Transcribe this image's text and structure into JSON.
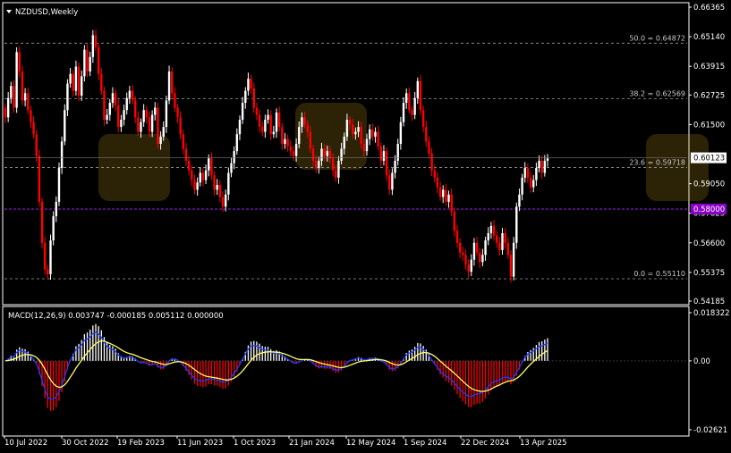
{
  "chart_title": "NZDUSD,Weekly",
  "macd_label": "MACD(12,26,9) 0.003747 -0.000185 0.005112 0.000000",
  "colors": {
    "background": "#000000",
    "bull_candle": "#ffffff",
    "bear_candle": "#ff0000",
    "macd_hist_pos": "#ffffff",
    "macd_hist_neg": "#ff0000",
    "macd_line": "#1e3cff",
    "signal_line": "#ffff66",
    "level_line": "#a020f0",
    "price_badge": "#ffffff",
    "level_badge": "#8a00c8"
  },
  "chart_data": [
    {
      "type": "candlestick",
      "title": "NZDUSD,Weekly",
      "ylim": [
        0.54185,
        0.66365
      ],
      "y_ticks": [
        "0.66365",
        "0.65140",
        "0.63915",
        "0.62725",
        "0.61500",
        "0.60123",
        "0.59050",
        "0.57825",
        "0.56600",
        "0.55375",
        "0.54185"
      ],
      "x_ticks": [
        "10 Jul 2022",
        "30 Oct 2022",
        "19 Feb 2023",
        "11 Jun 2023",
        "1 Oct 2023",
        "21 Jan 2024",
        "12 May 2024",
        "1 Sep 2024",
        "22 Dec 2024",
        "13 Apr 2025"
      ],
      "current_price": "0.60123",
      "horizontal_level": "0.58000",
      "fibonacci": [
        {
          "label": "50.0 = 0.64872",
          "value": 0.64872
        },
        {
          "label": "38.2 = 0.62569",
          "value": 0.62569
        },
        {
          "label": "23.6 = 0.59718",
          "value": 0.59718
        },
        {
          "label": "0.0 = 0.55110",
          "value": 0.5511
        }
      ],
      "closes": [
        0.618,
        0.626,
        0.631,
        0.622,
        0.645,
        0.637,
        0.625,
        0.628,
        0.621,
        0.616,
        0.611,
        0.602,
        0.583,
        0.566,
        0.555,
        0.553,
        0.567,
        0.577,
        0.583,
        0.597,
        0.608,
        0.621,
        0.632,
        0.636,
        0.629,
        0.639,
        0.627,
        0.635,
        0.646,
        0.637,
        0.643,
        0.652,
        0.647,
        0.636,
        0.629,
        0.617,
        0.619,
        0.624,
        0.628,
        0.623,
        0.614,
        0.617,
        0.621,
        0.626,
        0.629,
        0.625,
        0.618,
        0.612,
        0.616,
        0.621,
        0.618,
        0.612,
        0.619,
        0.622,
        0.607,
        0.61,
        0.614,
        0.625,
        0.637,
        0.628,
        0.622,
        0.618,
        0.611,
        0.605,
        0.6,
        0.596,
        0.592,
        0.588,
        0.591,
        0.595,
        0.592,
        0.596,
        0.601,
        0.594,
        0.588,
        0.59,
        0.585,
        0.581,
        0.586,
        0.595,
        0.599,
        0.604,
        0.611,
        0.617,
        0.624,
        0.629,
        0.634,
        0.63,
        0.622,
        0.619,
        0.614,
        0.612,
        0.617,
        0.619,
        0.611,
        0.612,
        0.62,
        0.614,
        0.607,
        0.609,
        0.606,
        0.604,
        0.602,
        0.607,
        0.614,
        0.618,
        0.615,
        0.612,
        0.605,
        0.6,
        0.597,
        0.6,
        0.605,
        0.602,
        0.604,
        0.601,
        0.596,
        0.593,
        0.6,
        0.605,
        0.61,
        0.617,
        0.615,
        0.611,
        0.612,
        0.614,
        0.607,
        0.604,
        0.609,
        0.613,
        0.61,
        0.612,
        0.606,
        0.6,
        0.604,
        0.594,
        0.588,
        0.595,
        0.6,
        0.607,
        0.616,
        0.624,
        0.628,
        0.621,
        0.619,
        0.626,
        0.633,
        0.621,
        0.614,
        0.608,
        0.603,
        0.596,
        0.593,
        0.589,
        0.585,
        0.588,
        0.583,
        0.586,
        0.579,
        0.571,
        0.566,
        0.562,
        0.561,
        0.557,
        0.554,
        0.559,
        0.566,
        0.562,
        0.558,
        0.561,
        0.567,
        0.57,
        0.573,
        0.569,
        0.566,
        0.563,
        0.57,
        0.566,
        0.561,
        0.552,
        0.566,
        0.581,
        0.586,
        0.593,
        0.597,
        0.593,
        0.589,
        0.592,
        0.597,
        0.6,
        0.595,
        0.6,
        0.601
      ]
    },
    {
      "type": "macd",
      "title": "MACD(12,26,9)",
      "ylim": [
        -0.02621,
        0.018322
      ],
      "y_ticks": [
        "0.018322",
        "0.00",
        "-0.02621"
      ],
      "values": {
        "macd": 0.003747,
        "signal": -0.000185,
        "histogram": 0.005112,
        "extra": 0.0
      }
    }
  ]
}
